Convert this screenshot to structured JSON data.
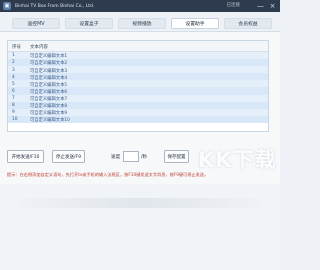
{
  "app": {
    "title": "Binhai TV Box From Binhai Co., Ltd.",
    "status": "已连接",
    "controls": {
      "minimize": "—",
      "close": "×"
    }
  },
  "tabs": [
    {
      "label": "遥控MV",
      "active": false
    },
    {
      "label": "设置盒子",
      "active": false
    },
    {
      "label": "视频播放",
      "active": false
    },
    {
      "label": "设置助手",
      "active": true
    },
    {
      "label": "会员权益",
      "active": false
    }
  ],
  "table": {
    "headers": {
      "index": "序号",
      "content": "文本内容"
    },
    "rows": [
      {
        "index": "1",
        "text": "可自定义编辑文本1"
      },
      {
        "index": "2",
        "text": "可自定义编辑文本2"
      },
      {
        "index": "3",
        "text": "可自定义编辑文本3"
      },
      {
        "index": "4",
        "text": "可自定义编辑文本4"
      },
      {
        "index": "5",
        "text": "可自定义编辑文本5"
      },
      {
        "index": "6",
        "text": "可自定义编辑文本6"
      },
      {
        "index": "7",
        "text": "可自定义编辑文本7"
      },
      {
        "index": "8",
        "text": "可自定义编辑文本8"
      },
      {
        "index": "9",
        "text": "可自定义编辑文本9"
      },
      {
        "index": "10",
        "text": "可自定义编辑文本10"
      }
    ]
  },
  "controls": {
    "start_button": "开始发送/F10",
    "stop_button": "停止发送/F9",
    "speed_label": "速度",
    "speed_value": "",
    "speed_unit": "/秒",
    "save_button": "保存配置"
  },
  "tip": "提示：在右侧添加自定义语句，先打开tv或手机的输入法框区，按F10键发送文字消息，按F9键可停止发送。",
  "watermark": "KK下载"
}
